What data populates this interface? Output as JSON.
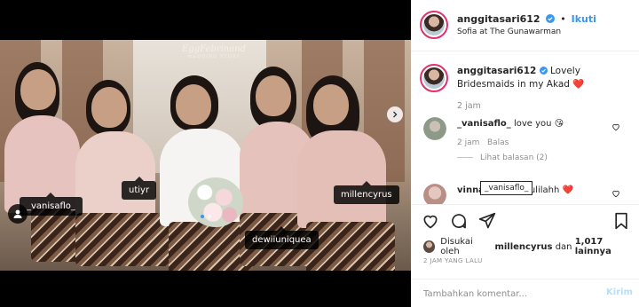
{
  "post": {
    "watermark": "EggFebrinand",
    "watermark_sub": "WEDDING STORY",
    "tags": [
      "_vanisaflo_",
      "utiyr",
      "dewiiuniquea",
      "millencyrus"
    ],
    "carousel": {
      "count": 2,
      "active": 0
    }
  },
  "header": {
    "username": "anggitasari612",
    "separator": "•",
    "follow_label": "Ikuti",
    "location": "Sofia at The Gunawarman"
  },
  "caption": {
    "username": "anggitasari612",
    "text": "Lovely Bridesmaids in my Akad",
    "emoji": "❤️",
    "time": "2 jam"
  },
  "comments": [
    {
      "username": "_vanisaflo_",
      "text": "love you",
      "emoji": "😘",
      "time": "2 jam",
      "meta_extra": "Balas",
      "replies_label": "Lihat balasan (2)"
    },
    {
      "username": "vinnafyt",
      "text": "Alhmdulilahh",
      "emoji": "❤️"
    }
  ],
  "hover_tooltip": "_vanisaflo_",
  "likes": {
    "prefix": "Disukai oleh",
    "user": "millencyrus",
    "joiner": "dan",
    "others": "1,017 lainnya"
  },
  "posted": "2 JAM YANG LALU",
  "composer": {
    "placeholder": "Tambahkan komentar...",
    "send_label": "Kirim"
  },
  "colors": {
    "accent": "#3897f0",
    "story_ring": "#e1306c",
    "heart_emoji": "#e0245e"
  }
}
